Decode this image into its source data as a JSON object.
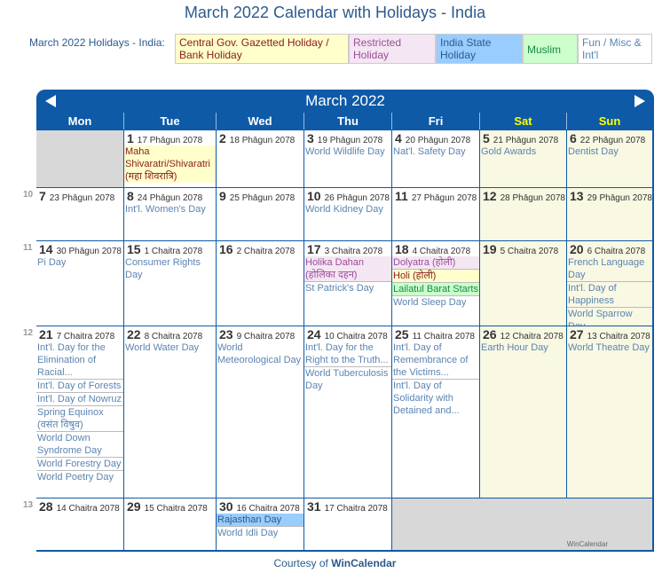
{
  "page_title": "March 2022 Calendar with Holidays - India",
  "legend": {
    "label": "March 2022 Holidays - India:",
    "items": [
      {
        "type": "gov",
        "label": "Central Gov. Gazetted Holiday / Bank Holiday"
      },
      {
        "type": "res",
        "label": "Restricted Holiday"
      },
      {
        "type": "state",
        "label": "India State Holiday"
      },
      {
        "type": "mus",
        "label": "Muslim"
      },
      {
        "type": "fun",
        "label": "Fun / Misc & Int'l"
      }
    ]
  },
  "calendar": {
    "month_title": "March 2022",
    "prev_icon": "triangle-left-icon",
    "next_icon": "triangle-right-icon",
    "weekdays": [
      "Mon",
      "Tue",
      "Wed",
      "Thu",
      "Fri",
      "Sat",
      "Sun"
    ],
    "weeks": [
      {
        "week_no": "",
        "days": [
          null,
          {
            "day": "1",
            "hindu": "17 Phāgun 2078",
            "events": [
              {
                "type": "gov",
                "text": "Maha Shivaratri/Shivaratri (महा शिवरात्रि)"
              }
            ]
          },
          {
            "day": "2",
            "hindu": "18 Phāgun 2078",
            "events": []
          },
          {
            "day": "3",
            "hindu": "19 Phāgun 2078",
            "events": [
              {
                "type": "fun",
                "text": "World Wildlife Day"
              }
            ]
          },
          {
            "day": "4",
            "hindu": "20 Phāgun 2078",
            "events": [
              {
                "type": "fun",
                "text": "Nat'l. Safety Day"
              }
            ]
          },
          {
            "day": "5",
            "hindu": "21 Phāgun 2078",
            "events": [
              {
                "type": "fun",
                "text": "Gold Awards"
              }
            ]
          },
          {
            "day": "6",
            "hindu": "22 Phāgun 2078",
            "events": [
              {
                "type": "fun",
                "text": "Dentist Day"
              }
            ]
          }
        ]
      },
      {
        "week_no": "10",
        "days": [
          {
            "day": "7",
            "hindu": "23 Phāgun 2078",
            "events": []
          },
          {
            "day": "8",
            "hindu": "24 Phāgun 2078",
            "events": [
              {
                "type": "fun",
                "text": "Int'l. Women's Day"
              }
            ]
          },
          {
            "day": "9",
            "hindu": "25 Phāgun 2078",
            "events": []
          },
          {
            "day": "10",
            "hindu": "26 Phāgun 2078",
            "events": [
              {
                "type": "fun",
                "text": "World Kidney Day"
              }
            ]
          },
          {
            "day": "11",
            "hindu": "27 Phāgun 2078",
            "events": []
          },
          {
            "day": "12",
            "hindu": "28 Phāgun 2078",
            "events": []
          },
          {
            "day": "13",
            "hindu": "29 Phāgun 2078",
            "events": []
          }
        ]
      },
      {
        "week_no": "11",
        "days": [
          {
            "day": "14",
            "hindu": "30 Phāgun 2078",
            "events": [
              {
                "type": "fun",
                "text": "Pi Day"
              }
            ]
          },
          {
            "day": "15",
            "hindu": "1 Chaitra 2078",
            "events": [
              {
                "type": "fun",
                "text": "Consumer Rights Day"
              }
            ]
          },
          {
            "day": "16",
            "hindu": "2 Chaitra 2078",
            "events": []
          },
          {
            "day": "17",
            "hindu": "3 Chaitra 2078",
            "events": [
              {
                "type": "res",
                "text": "Holika Dahan (होलिका दहन)"
              },
              {
                "type": "fun",
                "text": "St Patrick's Day"
              }
            ]
          },
          {
            "day": "18",
            "hindu": "4 Chaitra 2078",
            "events": [
              {
                "type": "res",
                "text": "Dolyatra (होली)"
              },
              {
                "type": "gov",
                "text": "Holi (होली)"
              },
              {
                "type": "mus",
                "text": "Lailatul Barat Starts"
              },
              {
                "type": "fun",
                "text": "World Sleep Day"
              }
            ]
          },
          {
            "day": "19",
            "hindu": "5 Chaitra 2078",
            "events": []
          },
          {
            "day": "20",
            "hindu": "6 Chaitra 2078",
            "events": [
              {
                "type": "fun",
                "text": "French Language Day"
              },
              {
                "type": "fun",
                "text": "Int'l. Day of Happiness"
              },
              {
                "type": "fun",
                "text": "World Sparrow Day"
              }
            ]
          }
        ]
      },
      {
        "week_no": "12",
        "days": [
          {
            "day": "21",
            "hindu": "7 Chaitra 2078",
            "events": [
              {
                "type": "fun",
                "text": "Int'l. Day for the Elimination of Racial..."
              },
              {
                "type": "fun",
                "text": "Int'l. Day of Forests"
              },
              {
                "type": "fun",
                "text": "Int'l. Day of Nowruz"
              },
              {
                "type": "fun",
                "text": "Spring Equinox (वसंत विषुव)"
              },
              {
                "type": "fun",
                "text": "World Down Syndrome Day"
              },
              {
                "type": "fun",
                "text": "World Forestry Day"
              },
              {
                "type": "fun",
                "text": "World Poetry Day"
              }
            ]
          },
          {
            "day": "22",
            "hindu": "8 Chaitra 2078",
            "events": [
              {
                "type": "fun",
                "text": "World Water Day"
              }
            ]
          },
          {
            "day": "23",
            "hindu": "9 Chaitra 2078",
            "events": [
              {
                "type": "fun",
                "text": "World Meteorological Day"
              }
            ]
          },
          {
            "day": "24",
            "hindu": "10 Chaitra 2078",
            "events": [
              {
                "type": "fun",
                "text": "Int'l. Day for the Right to the Truth..."
              },
              {
                "type": "fun",
                "text": "World Tuberculosis Day"
              }
            ]
          },
          {
            "day": "25",
            "hindu": "11 Chaitra 2078",
            "events": [
              {
                "type": "fun",
                "text": "Int'l. Day of Remembrance of the Victims..."
              },
              {
                "type": "fun",
                "text": "Int'l. Day of Solidarity with Detained and..."
              }
            ]
          },
          {
            "day": "26",
            "hindu": "12 Chaitra 2078",
            "events": [
              {
                "type": "fun",
                "text": "Earth Hour Day"
              }
            ]
          },
          {
            "day": "27",
            "hindu": "13 Chaitra 2078",
            "events": [
              {
                "type": "fun",
                "text": "World Theatre Day"
              }
            ]
          }
        ]
      },
      {
        "week_no": "13",
        "days": [
          {
            "day": "28",
            "hindu": "14 Chaitra 2078",
            "events": []
          },
          {
            "day": "29",
            "hindu": "15 Chaitra 2078",
            "events": []
          },
          {
            "day": "30",
            "hindu": "16 Chaitra 2078",
            "events": [
              {
                "type": "state",
                "text": "Rajasthan Day"
              },
              {
                "type": "fun",
                "text": "World Idli Day"
              }
            ]
          },
          {
            "day": "31",
            "hindu": "17 Chaitra 2078",
            "events": []
          },
          null,
          null,
          null
        ]
      }
    ],
    "watermark": "WinCalendar"
  },
  "footer": {
    "courtesy_text": "Courtesy of ",
    "courtesy_link": "WinCalendar"
  }
}
